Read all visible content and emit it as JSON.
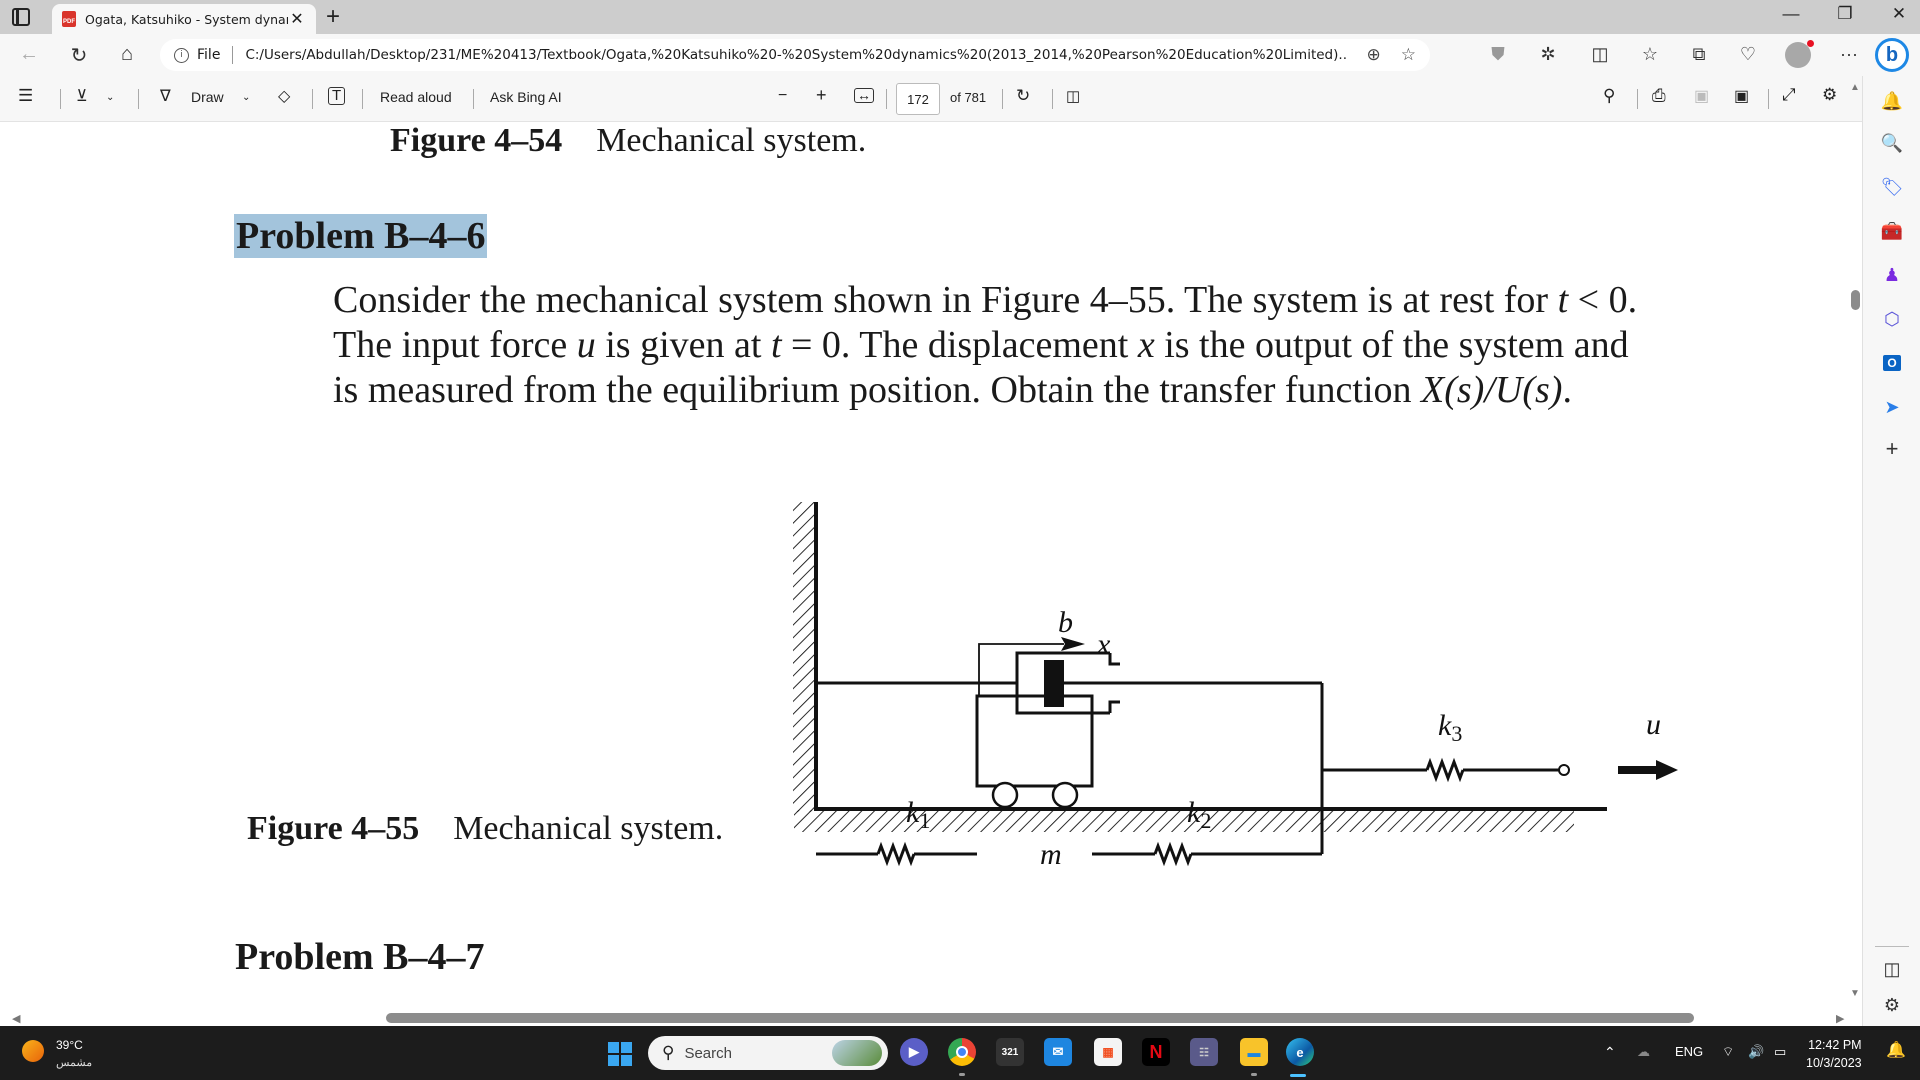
{
  "browser": {
    "tab": {
      "title": "Ogata, Katsuhiko - System dynan",
      "icon": "pdf-icon"
    },
    "window_controls": [
      "minimize",
      "restore",
      "close"
    ],
    "address": {
      "scheme_label": "File",
      "url": "C:/Users/Abdullah/Desktop/231/ME%20413/Textbook/Ogata,%20Katsuhiko%20-%20System%20dynamics%20(2013_2014,%20Pearson%20Education%20Limited)...."
    },
    "toolbar_icons": [
      "zoom-icon",
      "favorite-star-icon",
      "shield-icon",
      "extensions-icon",
      "split-screen-icon",
      "favorites-icon",
      "collections-icon",
      "browser-essentials-icon",
      "profile-avatar",
      "more-icon",
      "bing-copilot-icon"
    ]
  },
  "pdf_toolbar": {
    "draw_label": "Draw",
    "read_aloud_label": "Read aloud",
    "ask_bing_label": "Ask Bing AI",
    "page_current": "172",
    "page_total_label": "of 781"
  },
  "document": {
    "fig54_number": "Figure 4–54",
    "fig54_caption": "Mechanical system.",
    "problem6_title": "Problem B–4–6",
    "problem6_text": {
      "l1_a": "Consider the mechanical system shown in Figure 4–55. The system is at rest for ",
      "l1_var": "t",
      "l1_b": " < 0.",
      "l2_a": "The input force ",
      "l2_u": "u",
      "l2_b": " is given at ",
      "l2_t": "t",
      "l2_c": " = 0. The displacement ",
      "l2_x": "x",
      "l2_d": " is the output of the system and",
      "l3_a": "is measured from the equilibrium position. Obtain the transfer function ",
      "l3_tf": "X(s)/U(s)",
      "l3_b": "."
    },
    "diagram_labels": {
      "damper": "b",
      "displacement": "x",
      "k1": "k",
      "k1_sub": "1",
      "k2": "k",
      "k2_sub": "2",
      "k3": "k",
      "k3_sub": "3",
      "mass": "m",
      "force": "u"
    },
    "fig55_number": "Figure 4–55",
    "fig55_caption": "Mechanical system.",
    "problem7_title": "Problem B–4–7"
  },
  "sidebar": [
    "notifications-icon",
    "search-icon",
    "shopping-icon",
    "tools-icon",
    "games-icon",
    "microsoft365-icon",
    "outlook-icon",
    "drop-icon",
    "add-icon",
    "sidebar-toggle-icon",
    "settings-icon"
  ],
  "taskbar": {
    "weather_temp": "39°C",
    "weather_desc": "مشمس",
    "search_placeholder": "Search",
    "language": "ENG",
    "time": "12:42 PM",
    "date": "10/3/2023"
  }
}
